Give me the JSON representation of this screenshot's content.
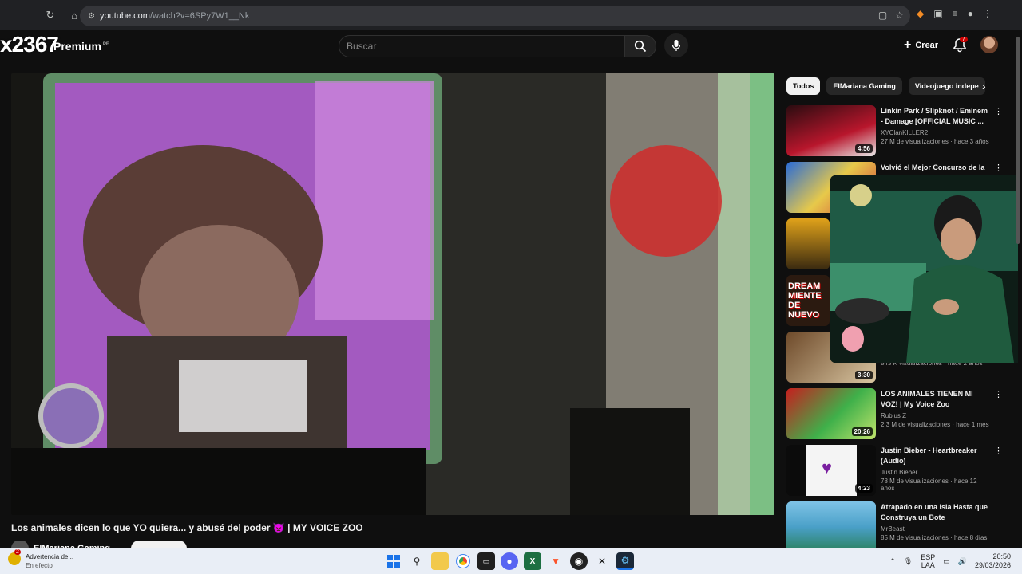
{
  "browser": {
    "url_host": "youtube.com",
    "url_path": "/watch?v=6SPy7W1__Nk"
  },
  "header": {
    "overlay_text": "x2367",
    "brand": "Premium",
    "brand_sup": "PE",
    "search_placeholder": "Buscar",
    "create_label": "Crear",
    "notification_count": "7"
  },
  "video": {
    "title": "Los animales dicen lo que YO quiera... y abusé del poder 👿 | MY VOICE ZOO",
    "channel": "ElMariana Gaming"
  },
  "chips": [
    "Todos",
    "ElMariana Gaming",
    "Videojuego indepe"
  ],
  "recommendations": [
    {
      "title": "Linkin Park / Slipknot / Eminem - Damage [OFFICIAL MUSIC ...",
      "channel": "XYClanKILLER2",
      "meta": "27 M de visualizaciones · hace 3 años",
      "duration": "4:56",
      "thumb": "#b8162c"
    },
    {
      "title": "Volvió el Mejor Concurso de la Historia",
      "channel": "",
      "meta": "",
      "duration": "",
      "thumb": "#2a6bd6"
    },
    {
      "title": "",
      "channel": "",
      "meta": "",
      "duration": "",
      "thumb": "#e0a21a"
    },
    {
      "title": "",
      "channel": "",
      "meta": "",
      "duration": "",
      "thumb": "#7a1b1b"
    },
    {
      "title": "",
      "channel": "",
      "meta": "843 K visualizaciones · hace 2 años",
      "duration": "3:30",
      "thumb": "#6e4a2a"
    },
    {
      "title": "LOS ANIMALES TIENEN MI VOZ! | My Voice Zoo",
      "channel": "Rubius Z",
      "meta": "2,3 M de visualizaciones · hace 1 mes",
      "duration": "20:26",
      "thumb": "#3fb04a"
    },
    {
      "title": "Justin Bieber - Heartbreaker (Audio)",
      "channel": "Justin Bieber",
      "meta": "78 M de visualizaciones · hace 12 años",
      "duration": "4:23",
      "thumb": "#f2f2f2"
    },
    {
      "title": "Atrapado en una Isla Hasta que Construya un Bote",
      "channel": "MrBeast",
      "meta": "85 M de visualizaciones · hace 8 días",
      "duration": "",
      "thumb": "#4aa0c8"
    }
  ],
  "taskbar": {
    "notice_title": "Advertencia de...",
    "notice_sub": "En efecto",
    "lang_top": "ESP",
    "lang_bottom": "LAA",
    "time": "20:50",
    "date": "29/03/2026"
  }
}
